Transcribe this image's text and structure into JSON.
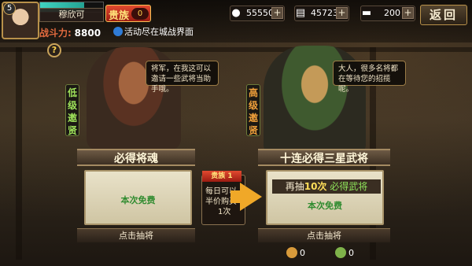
{
  "player": {
    "level": "5",
    "name": "穆欣可",
    "hp_fraction": 0.7,
    "vip_label": "贵族",
    "vip_level": "0",
    "power_label": "战斗力:",
    "power_value": "8800"
  },
  "notice": "活动尽在城战界面",
  "resources": [
    {
      "icon": "coin-icon",
      "value": "55550"
    },
    {
      "icon": "scroll-icon",
      "value": "45723"
    },
    {
      "icon": "gold-ingot-icon",
      "value": "200"
    }
  ],
  "plus_label": "+",
  "back_label": "返回",
  "help_label": "?",
  "low_recruit": {
    "banner": "低级邀贤",
    "speech": "将军，在我这可以邀请一些武将当助手哦。",
    "title": "必得将魂",
    "free_text": "本次免费",
    "draw_label": "点击抽将"
  },
  "high_recruit": {
    "banner": "高级邀贤",
    "speech": "大人，很多名将都在等待您的招揽呢。",
    "title": "十连必得三星武将",
    "draw_again_prefix": "再抽",
    "draw_again_count": "10次",
    "draw_again_suffix": "必得武将",
    "free_text": "本次免费",
    "draw_label": "点击抽将"
  },
  "promo": {
    "tag": "贵族 1",
    "text": "每日可以半价购买",
    "times": "1次"
  },
  "counters": [
    {
      "icon": "recruit-token-icon",
      "value": "0"
    },
    {
      "icon": "jade-token-icon",
      "value": "0"
    }
  ]
}
